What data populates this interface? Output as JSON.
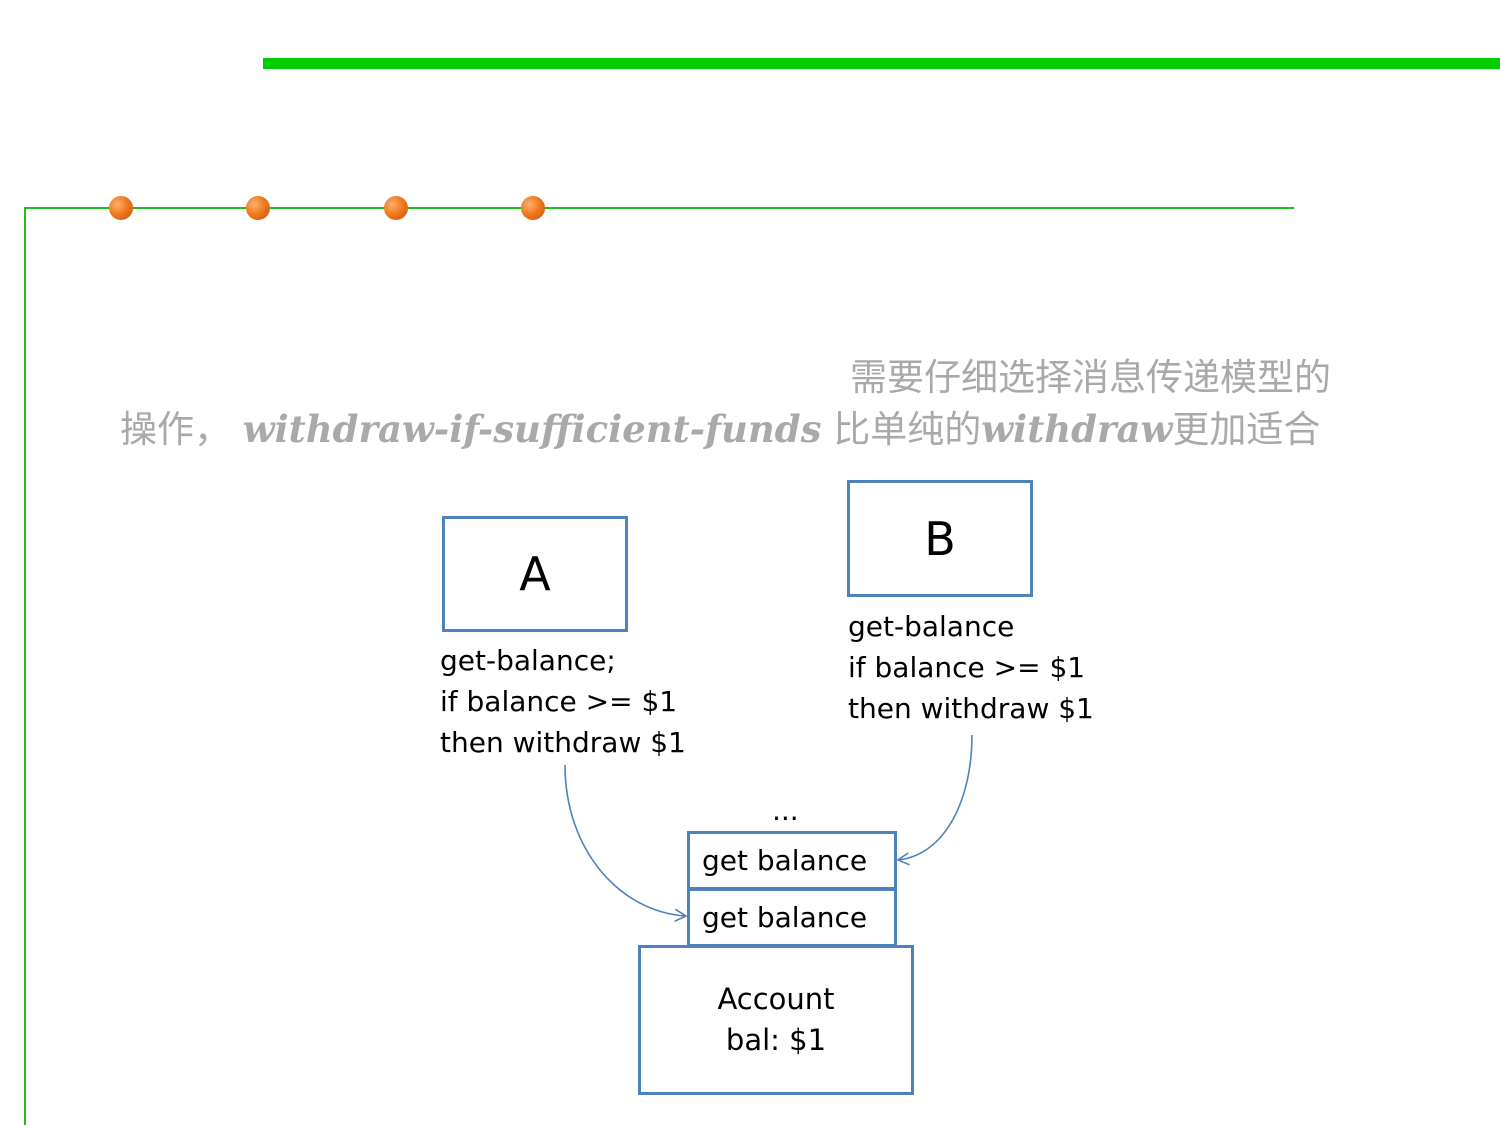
{
  "caption": {
    "line1": "需要仔细选择消息传递模型的",
    "line2_prefix": "操作，",
    "line2_italic1": "withdraw-if-sufficient-funds",
    "line2_mid": "比单纯的",
    "line2_italic2": "withdraw",
    "line2_suffix": "更加适合"
  },
  "diagram": {
    "process_a": {
      "label": "A",
      "code": [
        "get-balance;",
        "if balance >= $1",
        "then withdraw $1"
      ]
    },
    "process_b": {
      "label": "B",
      "code": [
        "get-balance",
        "if balance >= $1",
        "then withdraw $1"
      ]
    },
    "queue": {
      "ellipsis": "...",
      "items": [
        "get balance",
        "get balance"
      ]
    },
    "account": {
      "title": "Account",
      "balance": "bal: $1"
    }
  },
  "colors": {
    "top_bar": "#00cc00",
    "rules": "#22bb22",
    "bullets": "#f07a1e",
    "box_border": "#4f81bd",
    "caption_text": "#a9a9a9"
  }
}
